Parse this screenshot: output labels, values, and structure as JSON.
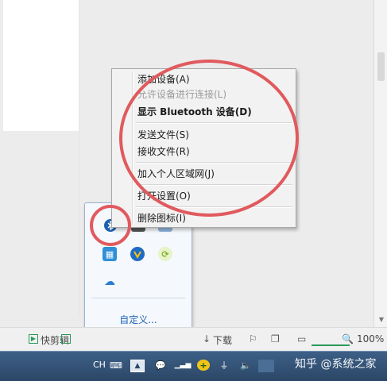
{
  "context_menu": {
    "items": [
      {
        "label": "添加设备(A)",
        "disabled": false,
        "bold": false
      },
      {
        "label": "允许设备进行连接(L)",
        "disabled": true,
        "bold": false
      },
      {
        "label": "显示 Bluetooth 设备(D)",
        "disabled": false,
        "bold": true
      },
      {
        "label": "发送文件(S)",
        "disabled": false,
        "bold": false
      },
      {
        "label": "接收文件(R)",
        "disabled": false,
        "bold": false
      },
      {
        "label": "加入个人区域网(J)",
        "disabled": false,
        "bold": false
      },
      {
        "label": "打开设置(O)",
        "disabled": false,
        "bold": false
      },
      {
        "label": "删除图标(I)",
        "disabled": false,
        "bold": false
      }
    ]
  },
  "tray_flyout": {
    "icons": [
      "bluetooth-icon",
      "network-adapter-icon",
      "window-icon",
      "app-blue-icon",
      "browser-v-icon",
      "sync-green-icon",
      "cloud-icon"
    ],
    "customize_label": "自定义..."
  },
  "status_bar": {
    "quick_clip_label": "快剪辑",
    "download_label": "下载",
    "zoom_label": "100%"
  },
  "taskbar": {
    "ime_label": "CH",
    "watermark": "知乎 @系统之家"
  },
  "colors": {
    "annotation_red": "#e05a5e",
    "taskbar": "#2b4767",
    "link_blue": "#1e63b8"
  }
}
